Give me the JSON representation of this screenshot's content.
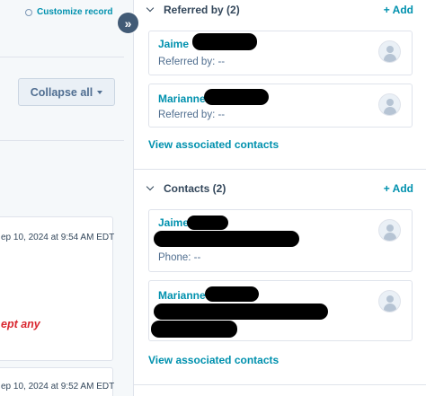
{
  "left": {
    "customize_label": "Customize record",
    "collapse_label": "Collapse all",
    "activities": [
      {
        "timestamp": "ep 10, 2024 at 9:54 AM EDT",
        "highlight": "ept any"
      },
      {
        "timestamp": "ep 10, 2024 at 9:52 AM EDT"
      }
    ]
  },
  "toggle": {
    "glyph": "»"
  },
  "sections": {
    "referred": {
      "title": "Referred by (2)",
      "add_label": "+ Add",
      "cards": [
        {
          "name": "Jaime",
          "detail": "Referred by:  --"
        },
        {
          "name": "Marianne",
          "detail": "Referred by:  --"
        }
      ],
      "view_link": "View associated contacts"
    },
    "contacts": {
      "title": "Contacts (2)",
      "add_label": "+ Add",
      "cards": [
        {
          "name": "Jaime",
          "detail": "Phone:  --"
        },
        {
          "name": "Marianne"
        }
      ],
      "view_link": "View associated contacts"
    }
  },
  "colors": {
    "link": "#0091ae",
    "text": "#33475b",
    "alert": "#d9262f",
    "toggle_bg": "#425b76"
  }
}
